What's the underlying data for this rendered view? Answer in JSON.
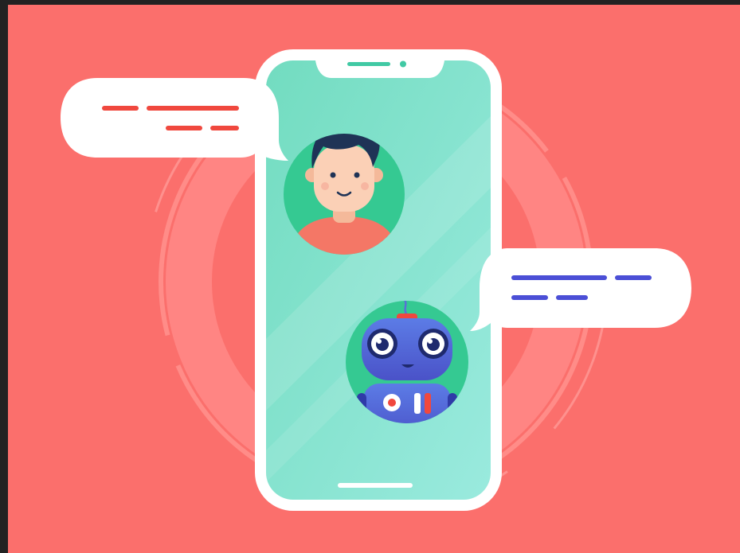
{
  "illustration": {
    "subject": "chatbot-conversation",
    "colors": {
      "background": "#fb6f6c",
      "outer_border": "#222222",
      "ring": "#ff8f8c",
      "phone_body": "#ffffff",
      "phone_screen": "#7fe0c6",
      "user_message_lines": "#f0483e",
      "bot_message_lines": "#4b4fd6",
      "user_avatar_bg": "#3ccf9b",
      "bot_avatar_bg": "#3ccf9b",
      "robot_blue": "#5a6fd8",
      "user_shirt": "#f47766",
      "user_hair": "#1f3356"
    },
    "icons": [
      "phone-icon",
      "user-avatar-icon",
      "robot-avatar-icon",
      "speech-bubble-icon"
    ],
    "user_bubble_line_count": 4,
    "bot_bubble_line_count": 4
  }
}
